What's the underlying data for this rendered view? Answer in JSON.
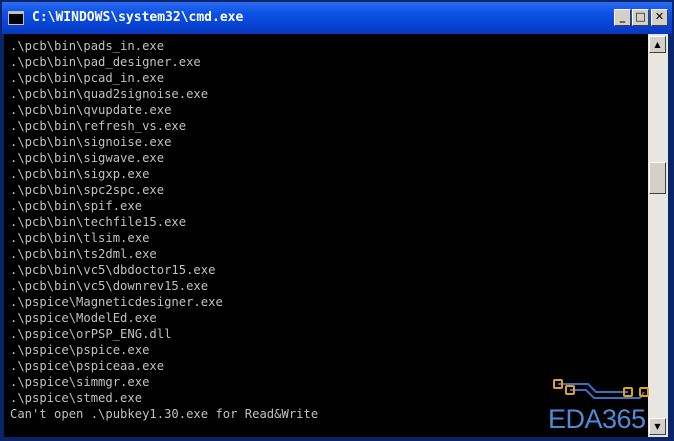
{
  "window": {
    "title": "C:\\WINDOWS\\system32\\cmd.exe",
    "icon_label": "C:\\",
    "buttons": {
      "minimize": "_",
      "maximize": "□",
      "close": "✕"
    }
  },
  "console": {
    "lines": [
      ".\\pcb\\bin\\pads_in.exe",
      ".\\pcb\\bin\\pad_designer.exe",
      ".\\pcb\\bin\\pcad_in.exe",
      ".\\pcb\\bin\\quad2signoise.exe",
      ".\\pcb\\bin\\qvupdate.exe",
      ".\\pcb\\bin\\refresh_vs.exe",
      ".\\pcb\\bin\\signoise.exe",
      ".\\pcb\\bin\\sigwave.exe",
      ".\\pcb\\bin\\sigxp.exe",
      ".\\pcb\\bin\\spc2spc.exe",
      ".\\pcb\\bin\\spif.exe",
      ".\\pcb\\bin\\techfile15.exe",
      ".\\pcb\\bin\\tlsim.exe",
      ".\\pcb\\bin\\ts2dml.exe",
      ".\\pcb\\bin\\vc5\\dbdoctor15.exe",
      ".\\pcb\\bin\\vc5\\downrev15.exe",
      ".\\pspice\\Magneticdesigner.exe",
      ".\\pspice\\ModelEd.exe",
      ".\\pspice\\orPSP_ENG.dll",
      ".\\pspice\\pspice.exe",
      ".\\pspice\\pspiceaa.exe",
      ".\\pspice\\simmgr.exe",
      ".\\pspice\\stmed.exe",
      "Can't open .\\pubkey1.30.exe for Read&Write"
    ]
  },
  "scrollbar": {
    "up_arrow": "▲",
    "down_arrow": "▼"
  },
  "watermark": {
    "text": "EDA365",
    "color": "#4d8bd9",
    "pad_color": "#e0a020",
    "trace_color": "#3a6fc0"
  },
  "colors": {
    "title_bar": "#0c51e4",
    "console_bg": "#000000",
    "console_text": "#c0c0c0"
  }
}
